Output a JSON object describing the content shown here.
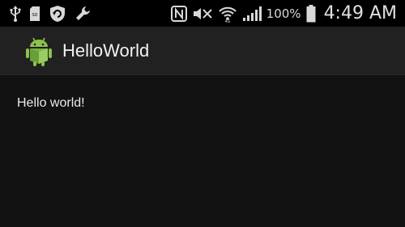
{
  "status_bar": {
    "left_icons": [
      "usb-icon",
      "sd-card-icon",
      "shield-refresh-icon",
      "wrench-icon"
    ],
    "right_icons": [
      "nfc-icon",
      "mute-icon",
      "wifi-icon",
      "signal-icon",
      "battery-icon"
    ],
    "battery_percent": "100%",
    "time": "4:49 AM"
  },
  "action_bar": {
    "app_icon": "android-robot-icon",
    "title": "HelloWorld"
  },
  "content": {
    "text": "Hello world!"
  },
  "colors": {
    "status_bar_bg": "#000000",
    "action_bar_bg": "#212121",
    "content_bg": "#121212",
    "android_green": "#8BC34A"
  }
}
